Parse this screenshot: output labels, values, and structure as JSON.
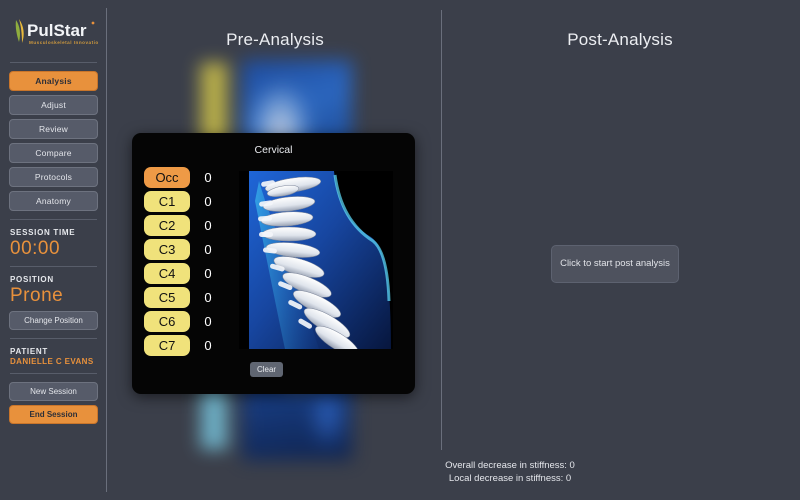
{
  "brand": {
    "name": "PulStar",
    "tagline": "Musculoskeletal Innovations",
    "accent": "#e8913c",
    "logo_green": "#7fa83c"
  },
  "sidebar": {
    "nav": [
      {
        "label": "Analysis",
        "active": true
      },
      {
        "label": "Adjust",
        "active": false
      },
      {
        "label": "Review",
        "active": false
      },
      {
        "label": "Compare",
        "active": false
      },
      {
        "label": "Protocols",
        "active": false
      },
      {
        "label": "Anatomy",
        "active": false
      }
    ],
    "session": {
      "label": "SESSION TIME",
      "value": "00:00"
    },
    "position": {
      "label": "POSITION",
      "value": "Prone",
      "change_button": "Change Position"
    },
    "patient": {
      "label": "PATIENT",
      "value": "DANIELLE C EVANS"
    },
    "actions": {
      "new_session": "New Session",
      "end_session": "End Session"
    }
  },
  "panes": {
    "pre_title": "Pre-Analysis",
    "post_title": "Post-Analysis",
    "post_start_button": "Click to start post analysis"
  },
  "modal": {
    "title": "Cervical",
    "clear_button": "Clear",
    "rows": [
      {
        "label": "Occ",
        "value": "0",
        "highlight": true
      },
      {
        "label": "C1",
        "value": "0",
        "highlight": false
      },
      {
        "label": "C2",
        "value": "0",
        "highlight": false
      },
      {
        "label": "C3",
        "value": "0",
        "highlight": false
      },
      {
        "label": "C4",
        "value": "0",
        "highlight": false
      },
      {
        "label": "C5",
        "value": "0",
        "highlight": false
      },
      {
        "label": "C6",
        "value": "0",
        "highlight": false
      },
      {
        "label": "C7",
        "value": "0",
        "highlight": false
      }
    ],
    "chip_color": "#f0e27b",
    "chip_highlight_color": "#ee9a46"
  },
  "footer": {
    "overall": "Overall decrease in stiffness: 0",
    "local": "Local decrease in stiffness: 0"
  }
}
